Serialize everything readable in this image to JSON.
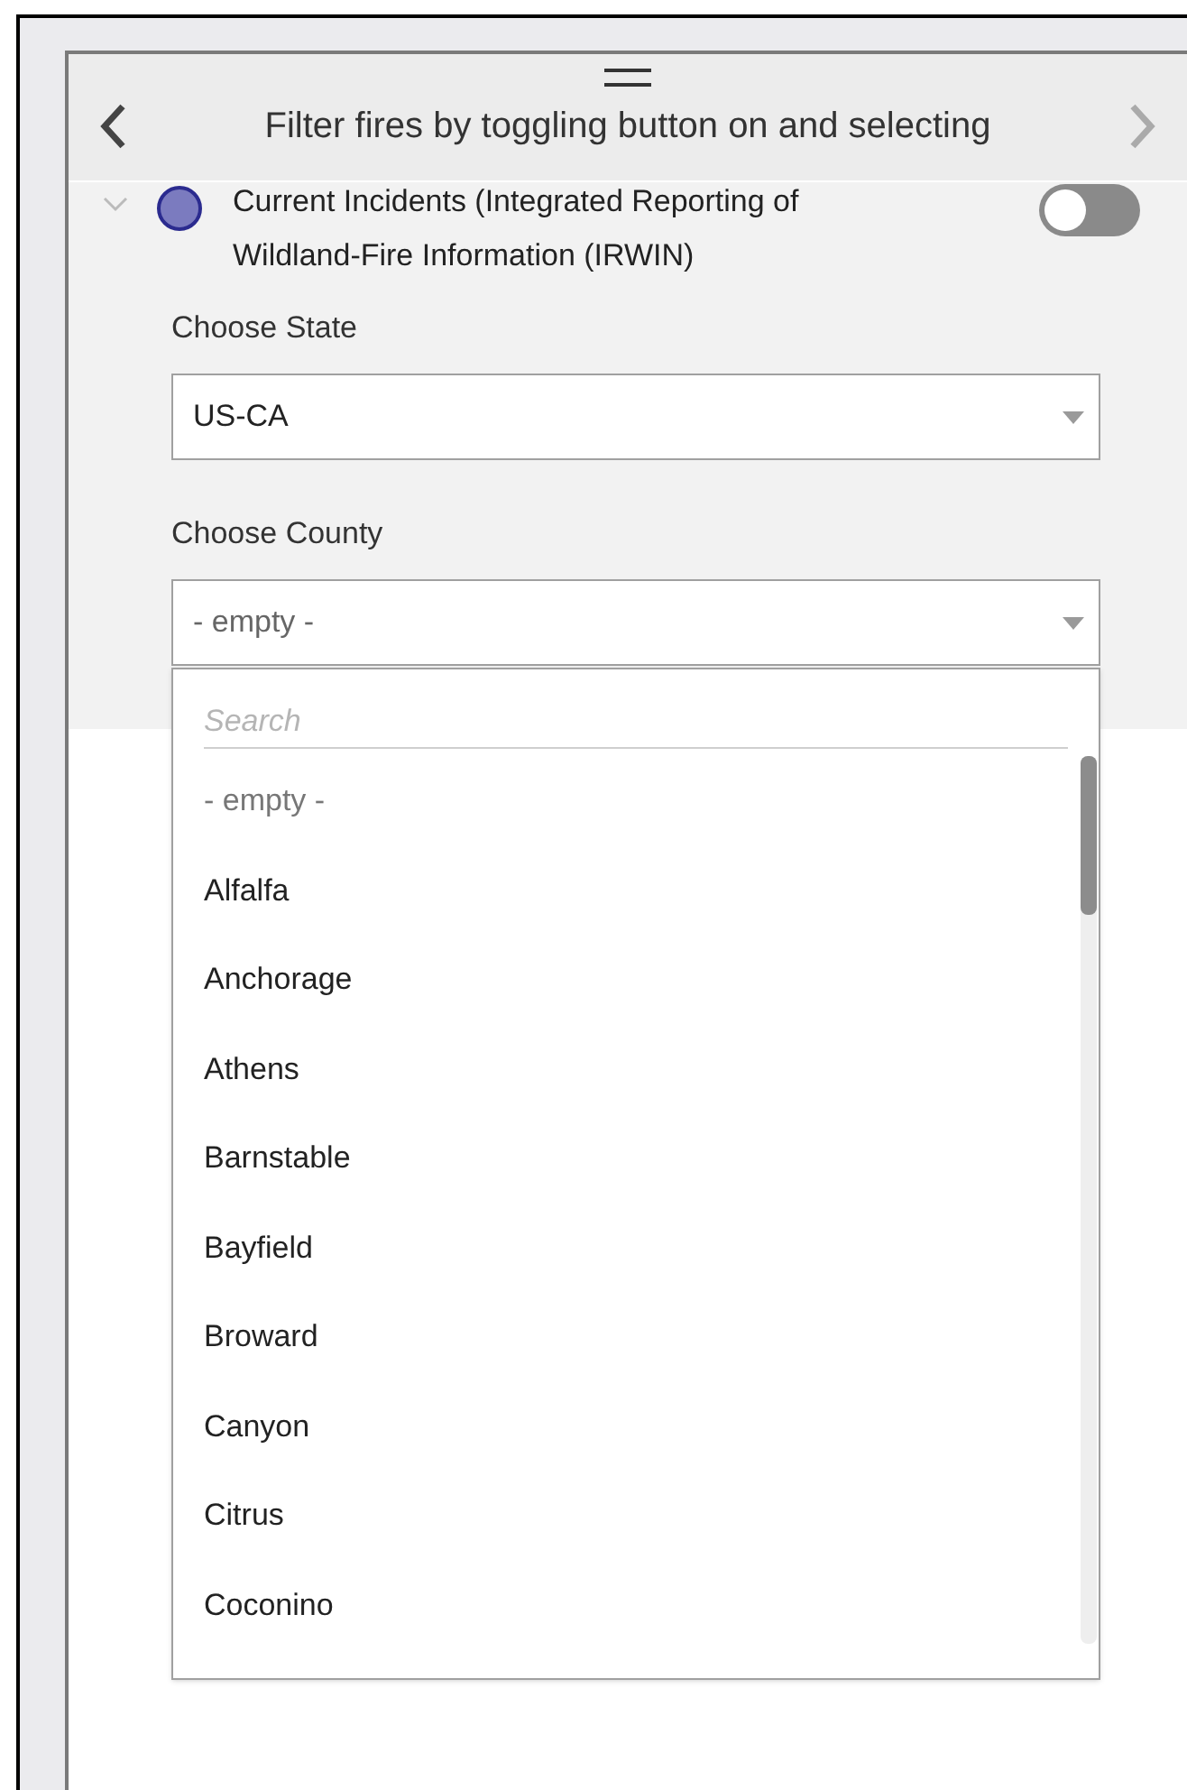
{
  "header": {
    "title": "Filter fires by toggling button on and selecting"
  },
  "layer": {
    "name": "Current Incidents (Integrated Reporting of Wildland-Fire Information (IRWIN)",
    "color": "#7b7bbf",
    "expanded": true,
    "on": false
  },
  "state_field": {
    "label": "Choose State",
    "value": "US-CA"
  },
  "county_field": {
    "label": "Choose County",
    "value": "- empty -",
    "open": true
  },
  "dropdown": {
    "search": {
      "placeholder": "Search"
    },
    "options": [
      {
        "label": "- empty -",
        "kind": "placeholder"
      },
      {
        "label": "Alfalfa",
        "kind": "option"
      },
      {
        "label": "Anchorage",
        "kind": "option"
      },
      {
        "label": "Athens",
        "kind": "option"
      },
      {
        "label": "Barnstable",
        "kind": "option"
      },
      {
        "label": "Bayfield",
        "kind": "option"
      },
      {
        "label": "Broward",
        "kind": "option"
      },
      {
        "label": "Canyon",
        "kind": "option"
      },
      {
        "label": "Citrus",
        "kind": "option"
      },
      {
        "label": "Coconino",
        "kind": "option"
      }
    ]
  }
}
